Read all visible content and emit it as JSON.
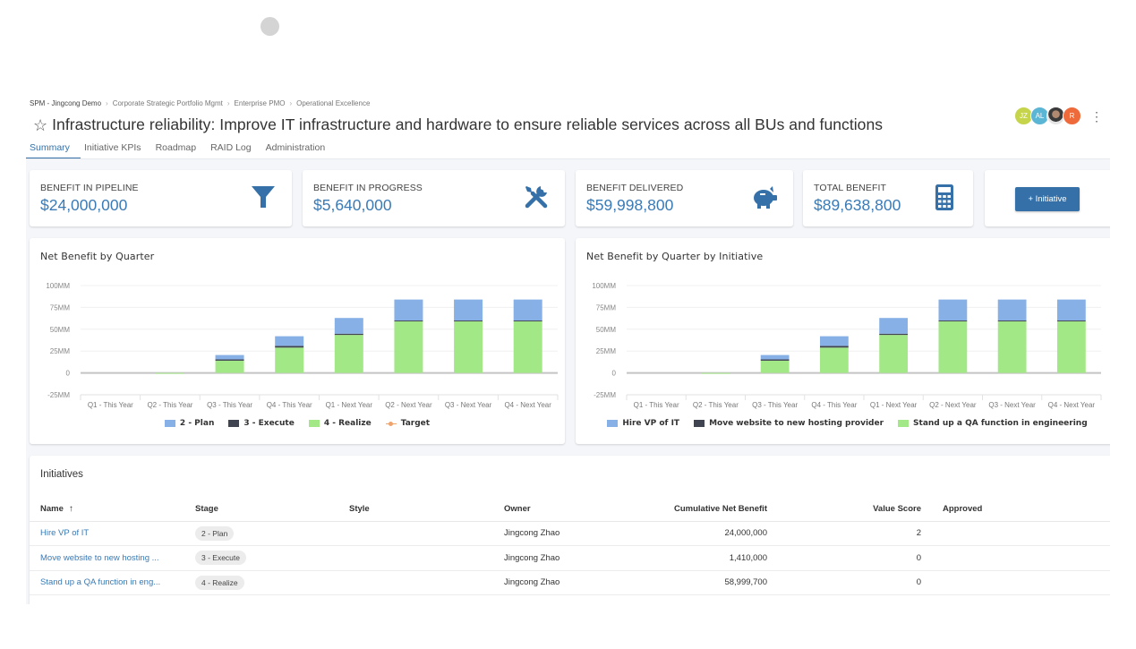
{
  "breadcrumb": [
    "SPM - Jingcong Demo",
    "Corporate Strategic Portfolio Mgmt",
    "Enterprise PMO",
    "Operational Excellence"
  ],
  "header": {
    "star_icon": "star-outline-icon",
    "title": "Infrastructure reliability: Improve IT infrastructure and hardware to ensure reliable services across all BUs and functions",
    "avatars": [
      {
        "initials": "JZ",
        "color": "#c5d44a"
      },
      {
        "initials": "AL",
        "color": "#5bb5d5"
      },
      {
        "initials": "",
        "color": "#555555",
        "photo": true
      },
      {
        "initials": "R",
        "color": "#ef6a3a"
      }
    ],
    "more_icon": "kebab-menu-icon"
  },
  "tabs": [
    {
      "label": "Summary",
      "active": true
    },
    {
      "label": "Initiative KPIs",
      "active": false
    },
    {
      "label": "Roadmap",
      "active": false
    },
    {
      "label": "RAID Log",
      "active": false
    },
    {
      "label": "Administration",
      "active": false
    }
  ],
  "kpis": [
    {
      "label": "Benefit in Pipeline",
      "value": "$24,000,000",
      "icon": "funnel-icon"
    },
    {
      "label": "Benefit in Progress",
      "value": "$5,640,000",
      "icon": "tools-icon"
    },
    {
      "label": "Benefit Delivered",
      "value": "$59,998,800",
      "icon": "piggy-bank-icon"
    },
    {
      "label": "Total Benefit",
      "value": "$89,638,800",
      "icon": "calculator-icon"
    }
  ],
  "add_initiative_label": "+ Initiative",
  "colors": {
    "accent": "#3571a8",
    "value_text": "#3a7ab5",
    "plan": "#86b0e6",
    "execute": "#3f4450",
    "realize": "#a3e887",
    "target": "#f0a36b"
  },
  "chart_data": [
    {
      "type": "bar",
      "stacked": true,
      "title": "Net Benefit by Quarter",
      "categories": [
        "Q1 - This Year",
        "Q2 - This Year",
        "Q3 - This Year",
        "Q4 - This Year",
        "Q1 - Next Year",
        "Q2 - Next Year",
        "Q3 - Next Year",
        "Q4 - Next Year"
      ],
      "series": [
        {
          "name": "4 - Realize",
          "color": "#a3e887",
          "values": [
            0,
            -1,
            14,
            29,
            43.5,
            59,
            59,
            59
          ]
        },
        {
          "name": "3 - Execute",
          "color": "#3f4450",
          "values": [
            0,
            0,
            1.5,
            2,
            1.4,
            1,
            1,
            1
          ]
        },
        {
          "name": "2 - Plan",
          "color": "#86b0e6",
          "values": [
            0,
            0,
            5,
            11,
            18,
            24,
            24,
            24
          ]
        }
      ],
      "target": {
        "name": "Target",
        "color": "#f0a36b",
        "values": []
      },
      "legend": [
        "2 - Plan",
        "3 - Execute",
        "4 - Realize",
        "Target"
      ],
      "yticks": [
        "100MM",
        "75MM",
        "50MM",
        "25MM",
        "0",
        "-25MM"
      ],
      "ylim": [
        -25,
        100
      ],
      "yunit": "MM",
      "xlabel": "",
      "ylabel": "",
      "grid": true,
      "legend_position": "bottom"
    },
    {
      "type": "bar",
      "stacked": true,
      "title": "Net Benefit by Quarter by Initiative",
      "categories": [
        "Q1 - This Year",
        "Q2 - This Year",
        "Q3 - This Year",
        "Q4 - This Year",
        "Q1 - Next Year",
        "Q2 - Next Year",
        "Q3 - Next Year",
        "Q4 - Next Year"
      ],
      "series": [
        {
          "name": "Stand up a QA function in engineering",
          "color": "#a3e887",
          "values": [
            0,
            -1,
            14,
            29,
            43.5,
            59,
            59,
            59
          ]
        },
        {
          "name": "Move website to new hosting provider",
          "color": "#3f4450",
          "values": [
            0,
            0,
            1.5,
            2,
            1.4,
            1,
            1,
            1
          ]
        },
        {
          "name": "Hire VP of IT",
          "color": "#86b0e6",
          "values": [
            0,
            0,
            5,
            11,
            18,
            24,
            24,
            24
          ]
        }
      ],
      "legend": [
        "Hire VP of IT",
        "Move website to new hosting provider",
        "Stand up a QA function in engineering"
      ],
      "yticks": [
        "100MM",
        "75MM",
        "50MM",
        "25MM",
        "0",
        "-25MM"
      ],
      "ylim": [
        -25,
        100
      ],
      "yunit": "MM",
      "xlabel": "",
      "ylabel": "",
      "grid": true,
      "legend_position": "bottom"
    }
  ],
  "initiatives": {
    "title": "Initiatives",
    "columns": [
      "Name",
      "Stage",
      "Style",
      "Owner",
      "Cumulative Net Benefit",
      "Value Score",
      "Approved"
    ],
    "sort_icon": "arrow-up-icon",
    "rows": [
      {
        "name": "Hire VP of IT",
        "stage": "2 - Plan",
        "style": "",
        "owner": "Jingcong Zhao",
        "benefit": "24,000,000",
        "score": "2",
        "approved": ""
      },
      {
        "name": "Move website to new hosting ...",
        "stage": "3 - Execute",
        "style": "",
        "owner": "Jingcong Zhao",
        "benefit": "1,410,000",
        "score": "0",
        "approved": ""
      },
      {
        "name": "Stand up a QA function in eng...",
        "stage": "4 - Realize",
        "style": "",
        "owner": "Jingcong Zhao",
        "benefit": "58,999,700",
        "score": "0",
        "approved": ""
      }
    ]
  }
}
